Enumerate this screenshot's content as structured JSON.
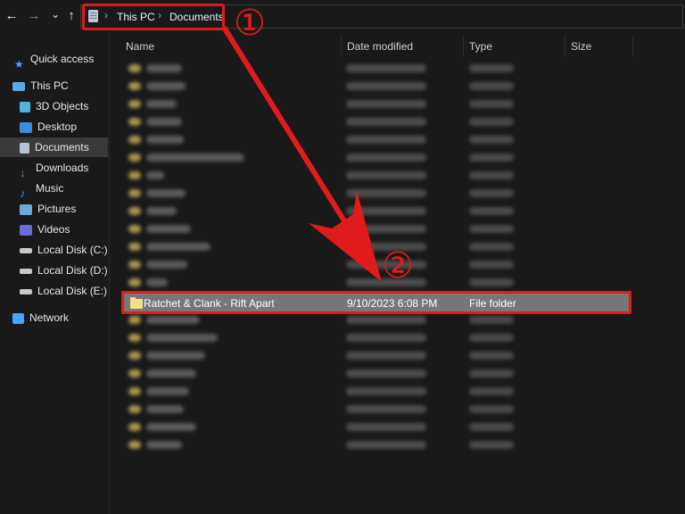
{
  "toolbar": {
    "back_icon": "←",
    "forward_icon": "→",
    "recent_icon": "⌄",
    "up_icon": "↑"
  },
  "breadcrumb": {
    "sep": "›",
    "items": [
      "This PC",
      "Documents"
    ]
  },
  "sidebar": {
    "items": [
      {
        "label": "Quick access",
        "icon": "star-icon",
        "color": "#4aa3ff"
      },
      {
        "label": "This PC",
        "icon": "computer-icon",
        "color": "#5aa9e6"
      },
      {
        "label": "3D Objects",
        "icon": "cube-icon",
        "color": "#52b4e8"
      },
      {
        "label": "Desktop",
        "icon": "desktop-icon",
        "color": "#3a8fd8"
      },
      {
        "label": "Documents",
        "icon": "document-icon",
        "color": "#b8c4d4"
      },
      {
        "label": "Downloads",
        "icon": "download-icon",
        "color": "#3f94e0"
      },
      {
        "label": "Music",
        "icon": "music-icon",
        "color": "#3f94e0"
      },
      {
        "label": "Pictures",
        "icon": "picture-icon",
        "color": "#6aa9d8"
      },
      {
        "label": "Videos",
        "icon": "video-icon",
        "color": "#6a6ad8"
      },
      {
        "label": "Local Disk (C:)",
        "icon": "disk-icon",
        "color": "#c8c8c8"
      },
      {
        "label": "Local Disk (D:)",
        "icon": "disk-icon",
        "color": "#c8c8c8"
      },
      {
        "label": "Local Disk (E:)",
        "icon": "disk-icon",
        "color": "#c8c8c8"
      },
      {
        "label": "Network",
        "icon": "network-icon",
        "color": "#4aa3ff"
      }
    ]
  },
  "columns": {
    "name": "Name",
    "date": "Date modified",
    "type": "Type",
    "size": "Size"
  },
  "selected_row": {
    "name": "Ratchet & Clank - Rift Apart",
    "date": "9/10/2023 6:08 PM",
    "type": "File folder"
  },
  "annotations": {
    "step1": "①",
    "step2": "②",
    "color": "#e01b1b"
  }
}
